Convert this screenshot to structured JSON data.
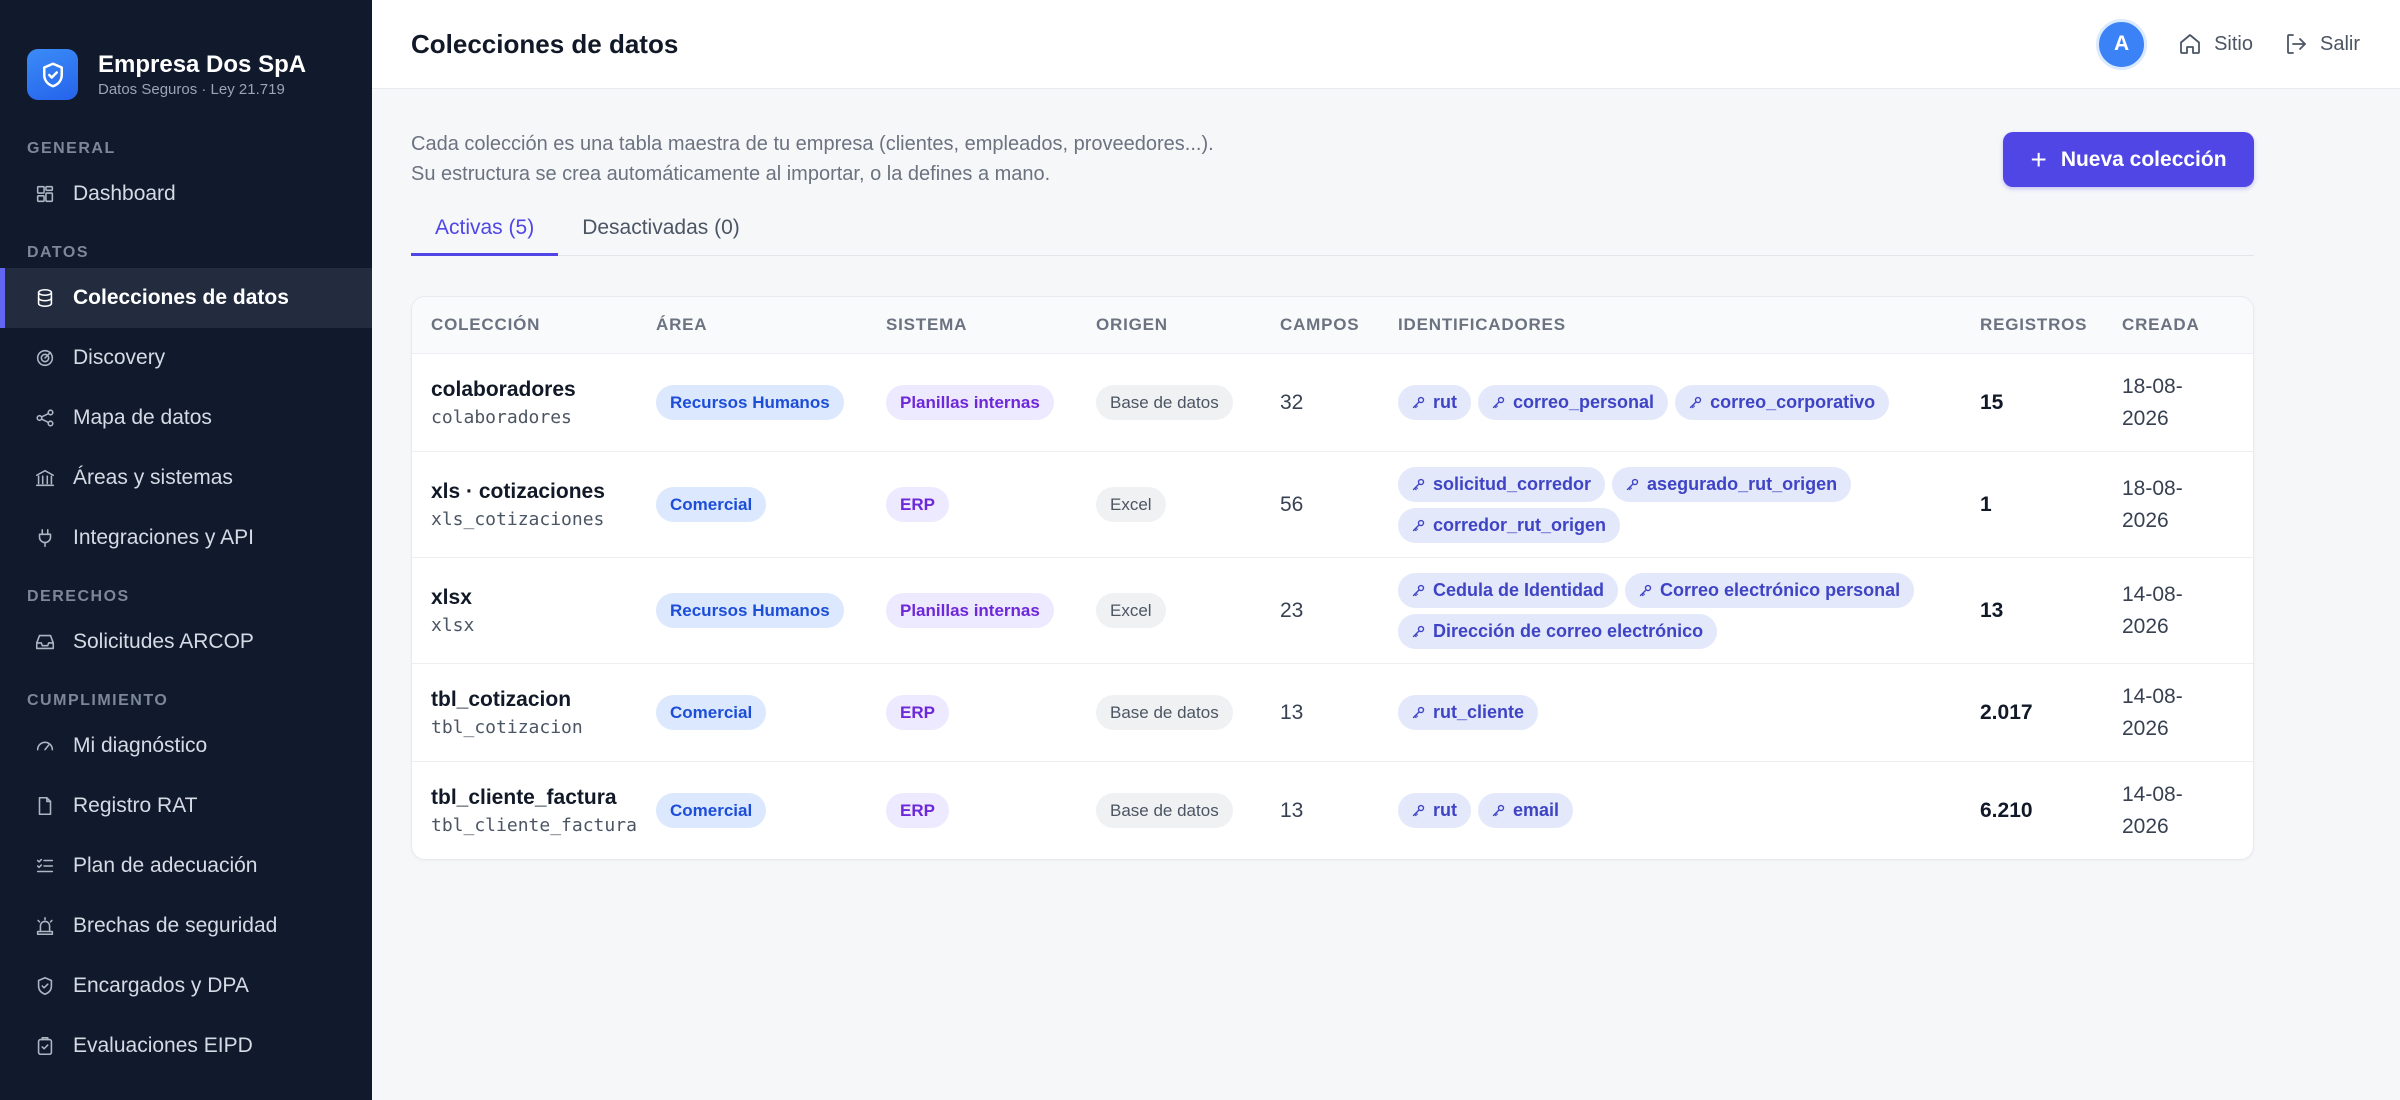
{
  "brand": {
    "name": "Empresa Dos SpA",
    "subtitle": "Datos Seguros · Ley 21.719"
  },
  "sidebar": {
    "sections": [
      {
        "title": "GENERAL",
        "items": [
          {
            "label": "Dashboard",
            "icon": "grid-icon",
            "active": false
          }
        ]
      },
      {
        "title": "DATOS",
        "items": [
          {
            "label": "Colecciones de datos",
            "icon": "database-icon",
            "active": true
          },
          {
            "label": "Discovery",
            "icon": "radar-icon",
            "active": false
          },
          {
            "label": "Mapa de datos",
            "icon": "share-icon",
            "active": false
          },
          {
            "label": "Áreas y sistemas",
            "icon": "bank-icon",
            "active": false
          },
          {
            "label": "Integraciones y API",
            "icon": "plug-icon",
            "active": false
          }
        ]
      },
      {
        "title": "DERECHOS",
        "items": [
          {
            "label": "Solicitudes ARCOP",
            "icon": "inbox-icon",
            "active": false
          }
        ]
      },
      {
        "title": "CUMPLIMIENTO",
        "items": [
          {
            "label": "Mi diagnóstico",
            "icon": "gauge-icon",
            "active": false
          },
          {
            "label": "Registro RAT",
            "icon": "file-icon",
            "active": false
          },
          {
            "label": "Plan de adecuación",
            "icon": "checklist-icon",
            "active": false
          },
          {
            "label": "Brechas de seguridad",
            "icon": "siren-icon",
            "active": false
          },
          {
            "label": "Encargados y DPA",
            "icon": "shield-handshake-icon",
            "active": false
          },
          {
            "label": "Evaluaciones EIPD",
            "icon": "clipboard-icon",
            "active": false
          }
        ]
      }
    ]
  },
  "header": {
    "title": "Colecciones de datos",
    "avatar_initial": "A",
    "site_label": "Sitio",
    "logout_label": "Salir"
  },
  "main": {
    "intro_line1": "Cada colección es una tabla maestra de tu empresa (clientes, empleados, proveedores...).",
    "intro_line2": "Su estructura se crea automáticamente al importar, o la defines a mano.",
    "new_button": "Nueva colección",
    "tabs": [
      {
        "label": "Activas (5)",
        "active": true
      },
      {
        "label": "Desactivadas (0)",
        "active": false
      }
    ]
  },
  "table": {
    "headers": [
      "COLECCIÓN",
      "ÁREA",
      "SISTEMA",
      "ORIGEN",
      "CAMPOS",
      "IDENTIFICADORES",
      "REGISTROS",
      "CREADA"
    ],
    "rows": [
      {
        "name": "colaboradores",
        "code": "colaboradores",
        "area": "Recursos Humanos",
        "system": "Planillas internas",
        "origin": "Base de datos",
        "fields": "32",
        "ids": [
          "rut",
          "correo_personal",
          "correo_corporativo"
        ],
        "records": "15",
        "created_1": "18-08-",
        "created_2": "2026"
      },
      {
        "name": "xls · cotizaciones",
        "code": "xls_cotizaciones",
        "area": "Comercial",
        "system": "ERP",
        "origin": "Excel",
        "fields": "56",
        "ids": [
          "solicitud_corredor",
          "asegurado_rut_origen",
          "corredor_rut_origen"
        ],
        "records": "1",
        "created_1": "18-08-",
        "created_2": "2026"
      },
      {
        "name": "xlsx",
        "code": "xlsx",
        "area": "Recursos Humanos",
        "system": "Planillas internas",
        "origin": "Excel",
        "fields": "23",
        "ids": [
          "Cedula de Identidad",
          "Correo electrónico personal",
          "Dirección de correo electrónico"
        ],
        "records": "13",
        "created_1": "14-08-",
        "created_2": "2026"
      },
      {
        "name": "tbl_cotizacion",
        "code": "tbl_cotizacion",
        "area": "Comercial",
        "system": "ERP",
        "origin": "Base de datos",
        "fields": "13",
        "ids": [
          "rut_cliente"
        ],
        "records": "2.017",
        "created_1": "14-08-",
        "created_2": "2026"
      },
      {
        "name": "tbl_cliente_factura",
        "code": "tbl_cliente_factura",
        "area": "Comercial",
        "system": "ERP",
        "origin": "Base de datos",
        "fields": "13",
        "ids": [
          "rut",
          "email"
        ],
        "records": "6.210",
        "created_1": "14-08-",
        "created_2": "2026"
      }
    ]
  },
  "colors": {
    "accent": "#4f46e5",
    "sidebar_bg": "#111a2c",
    "area_badge": "#dbe8fe",
    "system_badge": "#ede9fe"
  }
}
